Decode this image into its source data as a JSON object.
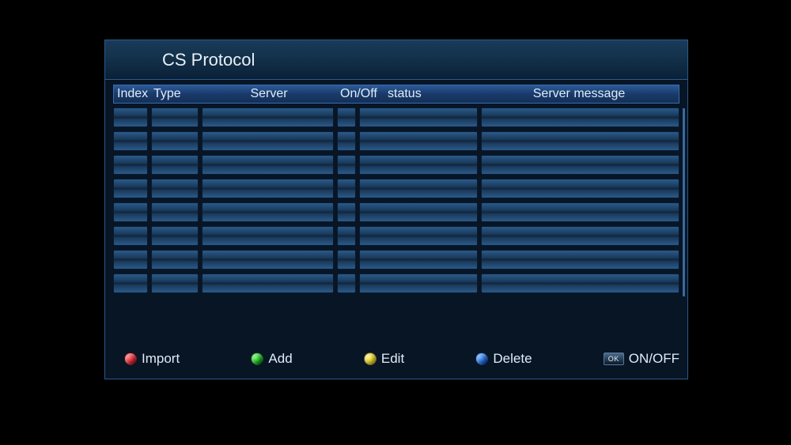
{
  "title": "CS Protocol",
  "columns": {
    "index": "Index",
    "type": "Type",
    "server": "Server",
    "onoff": "On/Off",
    "status": "status",
    "message": "Server message"
  },
  "rows": [
    {
      "index": "",
      "type": "",
      "server": "",
      "onoff": "",
      "status": "",
      "message": ""
    },
    {
      "index": "",
      "type": "",
      "server": "",
      "onoff": "",
      "status": "",
      "message": ""
    },
    {
      "index": "",
      "type": "",
      "server": "",
      "onoff": "",
      "status": "",
      "message": ""
    },
    {
      "index": "",
      "type": "",
      "server": "",
      "onoff": "",
      "status": "",
      "message": ""
    },
    {
      "index": "",
      "type": "",
      "server": "",
      "onoff": "",
      "status": "",
      "message": ""
    },
    {
      "index": "",
      "type": "",
      "server": "",
      "onoff": "",
      "status": "",
      "message": ""
    },
    {
      "index": "",
      "type": "",
      "server": "",
      "onoff": "",
      "status": "",
      "message": ""
    },
    {
      "index": "",
      "type": "",
      "server": "",
      "onoff": "",
      "status": "",
      "message": ""
    }
  ],
  "legend": {
    "red": "Import",
    "green": "Add",
    "yellow": "Edit",
    "blue": "Delete",
    "ok_badge": "OK",
    "ok": "ON/OFF"
  }
}
